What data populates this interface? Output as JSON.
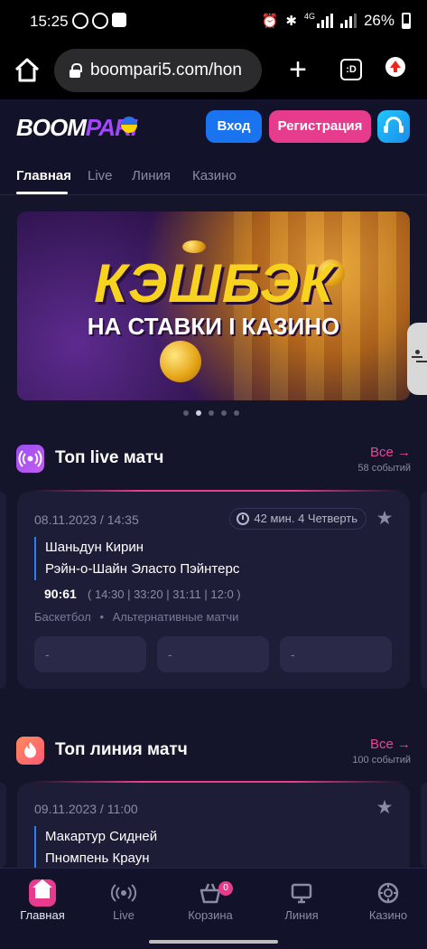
{
  "status_bar": {
    "time": "15:25",
    "left_icons": [
      "viber-icon",
      "viber-icon",
      "gallery-icon"
    ],
    "right_icons": [
      "alarm-icon",
      "bluetooth-icon",
      "4g-signal-icon",
      "signal-icon",
      "battery-icon"
    ],
    "network": "4G",
    "battery": "26%"
  },
  "browser": {
    "url": "boompari5.com/hon",
    "tabs_label": ":D"
  },
  "header": {
    "logo_part1": "BOOM",
    "logo_part2": "PARI",
    "login_label": "Вход",
    "register_label": "Регистрация",
    "colors": {
      "login": "#1a74f0",
      "register": "#e73c8e",
      "accent": "#a446ff"
    }
  },
  "nav_tabs": [
    {
      "label": "Главная",
      "active": true
    },
    {
      "label": "Live",
      "active": false
    },
    {
      "label": "Линия",
      "active": false
    },
    {
      "label": "Казино",
      "active": false
    }
  ],
  "banner": {
    "title": "КЭШБЭК",
    "subtitle": "НА СТАВКИ І КАЗИНО",
    "slide_count": 5,
    "active_slide": 2
  },
  "top_live": {
    "title": "Топ live матч",
    "all_label": "Все →",
    "count": "58 событий",
    "match": {
      "date": "08.11.2023 / 14:35",
      "timer": "42 мин. 4 Четверть",
      "team1": "Шаньдун Кирин",
      "team2": "Рэйн-о-Шайн Эласто Пэйнтерс",
      "score": "90:61",
      "periods": "( 14:30 | 33:20 | 31:11 | 12:0 )",
      "sport": "Баскетбол",
      "league": "Альтернативные матчи",
      "odds": [
        "-",
        "-",
        "-"
      ]
    }
  },
  "top_line": {
    "title": "Топ линия матч",
    "all_label": "Все →",
    "count": "100 событий",
    "match": {
      "date": "09.11.2023 / 11:00",
      "team1": "Макартур Сидней",
      "team2": "Пномпень Краун"
    }
  },
  "bottom_nav": [
    {
      "label": "Главная",
      "icon": "home-icon",
      "active": true
    },
    {
      "label": "Live",
      "icon": "live-broadcast-icon",
      "active": false
    },
    {
      "label": "Корзина",
      "icon": "basket-icon",
      "active": false,
      "badge": "0"
    },
    {
      "label": "Линия",
      "icon": "monitor-icon",
      "active": false
    },
    {
      "label": "Казино",
      "icon": "casino-chip-icon",
      "active": false
    }
  ]
}
